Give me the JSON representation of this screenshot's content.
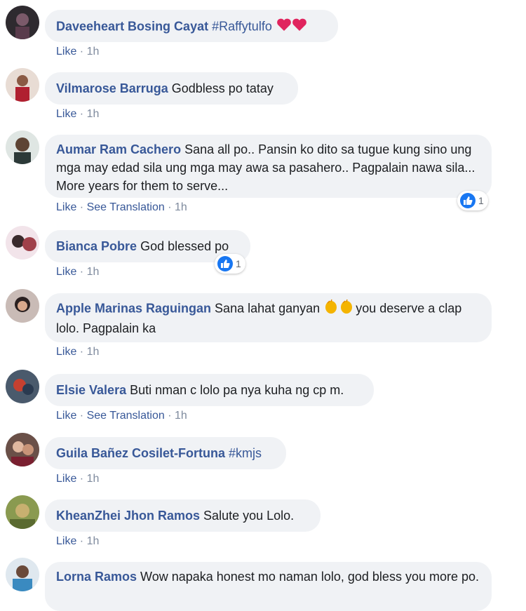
{
  "actions": {
    "like": "Like",
    "see_translation": "See Translation",
    "separator": " · "
  },
  "comments": [
    {
      "author": "Daveeheart Bosing Cayat",
      "text": "",
      "hashtag": "#Raffytulfo",
      "time": "1h"
    },
    {
      "author": "Vilmarose Barruga",
      "text": "Godbless po tatay",
      "time": "1h"
    },
    {
      "author": "Aumar Ram Cachero",
      "text": "Sana all po.. Pansin ko dito sa tugue kung sino ung mga may edad sila ung mga may awa sa pasahero.. Pagpalain nawa sila... More years for them to serve...",
      "time": "1h",
      "reactions": "1"
    },
    {
      "author": "Bianca Pobre",
      "text": "God blessed po",
      "time": "1h",
      "reactions": "1"
    },
    {
      "author": "Apple Marinas Raguingan",
      "text_before": "Sana lahat ganyan",
      "text_after": "you deserve a clap lolo. Pagpalain ka",
      "time": "1h"
    },
    {
      "author": "Elsie Valera",
      "text": "Buti nman c lolo pa nya kuha ng cp m.",
      "time": "1h"
    },
    {
      "author": "Guila Bañez Cosilet-Fortuna",
      "text": "",
      "hashtag": "#kmjs",
      "time": "1h"
    },
    {
      "author": "KheanZhei Jhon Ramos",
      "text": "Salute you Lolo.",
      "time": "1h"
    },
    {
      "author": "Lorna Ramos",
      "text": "Wow napaka honest mo naman lolo, god bless you more po."
    }
  ],
  "colors": {
    "author": "#385898",
    "bubble": "#f0f2f5",
    "meta": "#7f8b9e",
    "like_badge": "#1877f2"
  },
  "icons": [
    "heart-emoji-icon",
    "clap-emoji-icon",
    "thumbs-up-icon"
  ]
}
